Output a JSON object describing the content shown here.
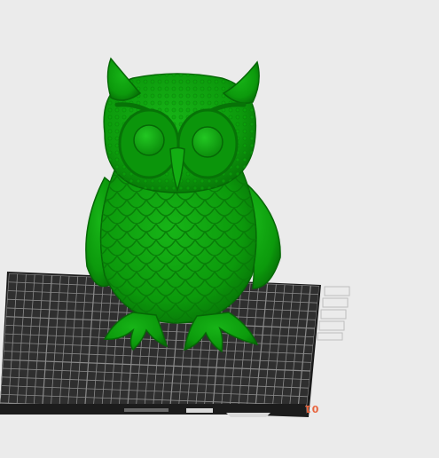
{
  "viewport": {
    "background": "#ebebeb"
  },
  "build_plate": {
    "surface_color": "#2f2f2f",
    "grid_color": "#8a8a8a",
    "edge_color": "#1c1c1c",
    "label": "01",
    "label_color": "#e8653f"
  },
  "model": {
    "name": "owl",
    "color": "#0c9a0c"
  },
  "view_controls": {
    "icons": [
      "view-top-icon",
      "view-front-icon",
      "view-side-icon",
      "view-iso-icon",
      "view-bottom-icon"
    ]
  }
}
